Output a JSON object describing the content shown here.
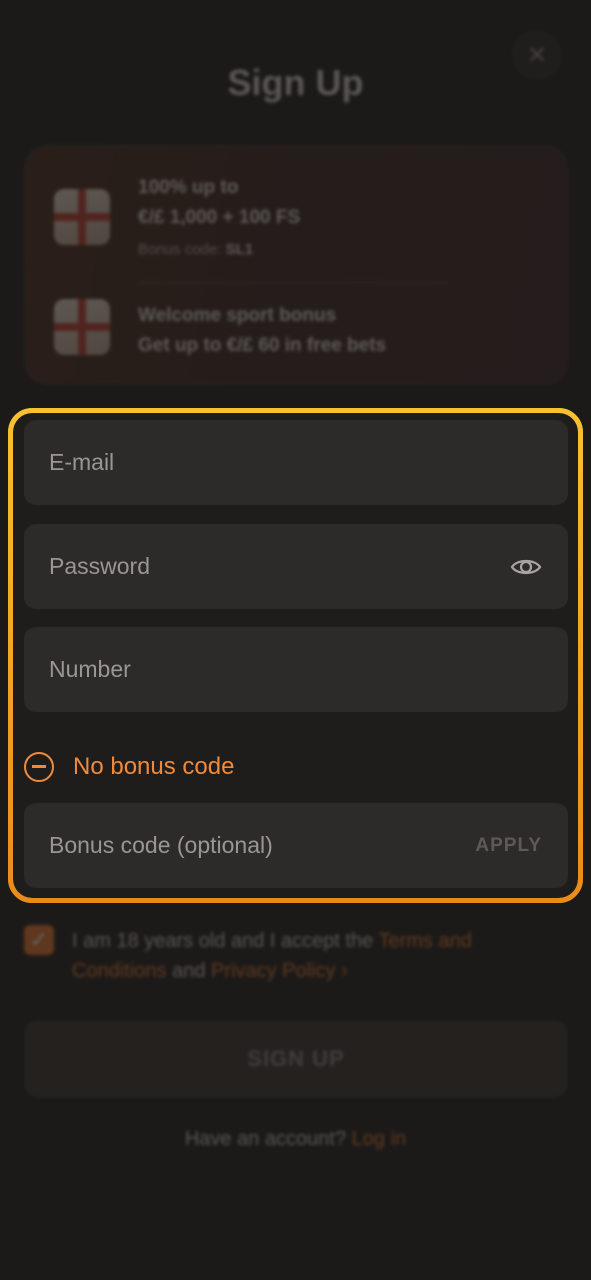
{
  "header": {
    "title": "Sign Up",
    "close_icon": "✕"
  },
  "bonuses": [
    {
      "line1": "100% up to",
      "line2": "€/£ 1,000 + 100 FS",
      "code_label": "Bonus code:",
      "code_value": "SL1",
      "icon": "gift-icon"
    },
    {
      "line1": "Welcome sport bonus",
      "line2": "Get up to €/£ 60 in free bets",
      "icon": "gift-icon"
    }
  ],
  "form": {
    "email_placeholder": "E-mail",
    "password_placeholder": "Password",
    "number_placeholder": "Number",
    "no_bonus_label": "No bonus code",
    "bonus_placeholder": "Bonus code (optional)",
    "apply_label": "APPLY"
  },
  "terms": {
    "text_before": "I am 18 years old and I accept the ",
    "terms_link": "Terms and Conditions",
    "text_and": " and ",
    "privacy_link": "Privacy Policy",
    "suffix": " ›"
  },
  "signup_button": "SIGN UP",
  "footer": {
    "text": "Have an account? ",
    "login_link": "Log in"
  },
  "colors": {
    "accent": "#f08a3a",
    "highlight_top": "#f6c22f",
    "highlight_bottom": "#ec8a18",
    "field_bg": "#2d2b29"
  }
}
